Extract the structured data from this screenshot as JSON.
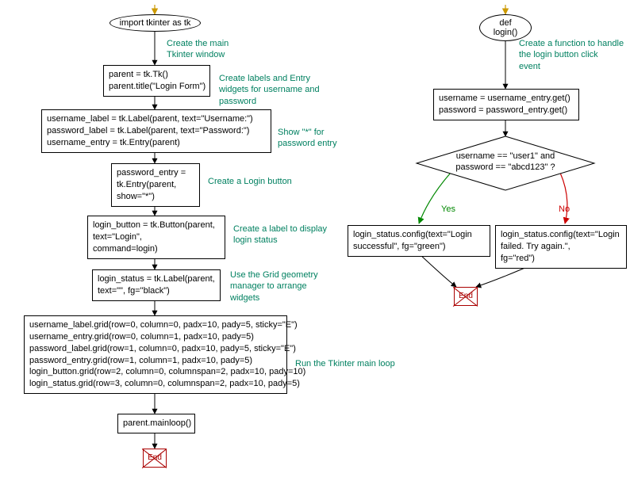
{
  "left": {
    "start": "import tkinter as tk",
    "a1": "Create the main\nTkinter window",
    "n1": "parent = tk.Tk()\nparent.title(\"Login Form\")",
    "a2": "Create labels and Entry\nwidgets for username and\npassword",
    "n2": "username_label = tk.Label(parent, text=\"Username:\")\npassword_label = tk.Label(parent, text=\"Password:\")\nusername_entry = tk.Entry(parent)",
    "a3": "Show \"*\" for\npassword entry",
    "n3": "password_entry =\ntk.Entry(parent,\nshow=\"*\")",
    "a4": "Create a Login button",
    "n4": "login_button = tk.Button(parent,\ntext=\"Login\",\ncommand=login)",
    "a5": "Create a label to display\nlogin status",
    "n5": "login_status = tk.Label(parent,\ntext=\"\", fg=\"black\")",
    "a6": "Use the Grid geometry\nmanager to arrange\nwidgets",
    "n6": "username_label.grid(row=0, column=0, padx=10, pady=5, sticky=\"E\")\nusername_entry.grid(row=0, column=1, padx=10, pady=5)\npassword_label.grid(row=1, column=0, padx=10, pady=5, sticky=\"E\")\npassword_entry.grid(row=1, column=1, padx=10, pady=5)\nlogin_button.grid(row=2, column=0, columnspan=2, padx=10, pady=10)\nlogin_status.grid(row=3, column=0, columnspan=2, padx=10, pady=5)",
    "a7": "Run the Tkinter main loop",
    "n7": "parent.mainloop()",
    "end": "End"
  },
  "right": {
    "start": "def login()",
    "a1": "Create a function to handle\nthe login button click\nevent",
    "n1": "username = username_entry.get()\npassword = password_entry.get()",
    "decision": "username == \"user1\" and\npassword == \"abcd123\" ?",
    "yes": "Yes",
    "no": "No",
    "nyes": "login_status.config(text=\"Login\nsuccessful\", fg=\"green\")",
    "nno": "login_status.config(text=\"Login\nfailed. Try again.\",\nfg=\"red\")",
    "end": "End"
  },
  "chart_data": {
    "type": "flowchart",
    "subgraphs": [
      {
        "id": "main",
        "nodes": [
          {
            "id": "L0",
            "shape": "ellipse",
            "text": "import tkinter as tk"
          },
          {
            "id": "L1",
            "shape": "rect",
            "text": "parent = tk.Tk()\nparent.title(\"Login Form\")"
          },
          {
            "id": "L2",
            "shape": "rect",
            "text": "username_label = tk.Label(parent, text=\"Username:\")\npassword_label = tk.Label(parent, text=\"Password:\")\nusername_entry = tk.Entry(parent)"
          },
          {
            "id": "L3",
            "shape": "rect",
            "text": "password_entry = tk.Entry(parent, show=\"*\")"
          },
          {
            "id": "L4",
            "shape": "rect",
            "text": "login_button = tk.Button(parent, text=\"Login\", command=login)"
          },
          {
            "id": "L5",
            "shape": "rect",
            "text": "login_status = tk.Label(parent, text=\"\", fg=\"black\")"
          },
          {
            "id": "L6",
            "shape": "rect",
            "text": "username_label.grid(row=0, column=0, padx=10, pady=5, sticky=\"E\")\nusername_entry.grid(row=0, column=1, padx=10, pady=5)\npassword_label.grid(row=1, column=0, padx=10, pady=5, sticky=\"E\")\npassword_entry.grid(row=1, column=1, padx=10, pady=5)\nlogin_button.grid(row=2, column=0, columnspan=2, padx=10, pady=10)\nlogin_status.grid(row=3, column=0, columnspan=2, padx=10, pady=5)"
          },
          {
            "id": "L7",
            "shape": "rect",
            "text": "parent.mainloop()"
          },
          {
            "id": "LE",
            "shape": "end",
            "text": "End"
          }
        ],
        "edges": [
          {
            "from": "L0",
            "to": "L1",
            "label": "Create the main Tkinter window"
          },
          {
            "from": "L1",
            "to": "L2",
            "label": "Create labels and Entry widgets for username and password"
          },
          {
            "from": "L2",
            "to": "L3",
            "label": "Show \"*\" for password entry"
          },
          {
            "from": "L3",
            "to": "L4",
            "label": "Create a Login button"
          },
          {
            "from": "L4",
            "to": "L5",
            "label": "Create a label to display login status"
          },
          {
            "from": "L5",
            "to": "L6",
            "label": "Use the Grid geometry manager to arrange widgets"
          },
          {
            "from": "L6",
            "to": "L7",
            "label": "Run the Tkinter main loop"
          },
          {
            "from": "L7",
            "to": "LE"
          }
        ]
      },
      {
        "id": "login_fn",
        "nodes": [
          {
            "id": "R0",
            "shape": "ellipse",
            "text": "def login()"
          },
          {
            "id": "R1",
            "shape": "rect",
            "text": "username = username_entry.get()\npassword = password_entry.get()"
          },
          {
            "id": "R2",
            "shape": "diamond",
            "text": "username == \"user1\" and password == \"abcd123\" ?"
          },
          {
            "id": "R3",
            "shape": "rect",
            "text": "login_status.config(text=\"Login successful\", fg=\"green\")"
          },
          {
            "id": "R4",
            "shape": "rect",
            "text": "login_status.config(text=\"Login failed. Try again.\", fg=\"red\")"
          },
          {
            "id": "RE",
            "shape": "end",
            "text": "End"
          }
        ],
        "edges": [
          {
            "from": "R0",
            "to": "R1",
            "label": "Create a function to handle the login button click event"
          },
          {
            "from": "R1",
            "to": "R2"
          },
          {
            "from": "R2",
            "to": "R3",
            "label": "Yes",
            "color": "green"
          },
          {
            "from": "R2",
            "to": "R4",
            "label": "No",
            "color": "red"
          },
          {
            "from": "R3",
            "to": "RE"
          },
          {
            "from": "R4",
            "to": "RE"
          }
        ]
      }
    ]
  }
}
